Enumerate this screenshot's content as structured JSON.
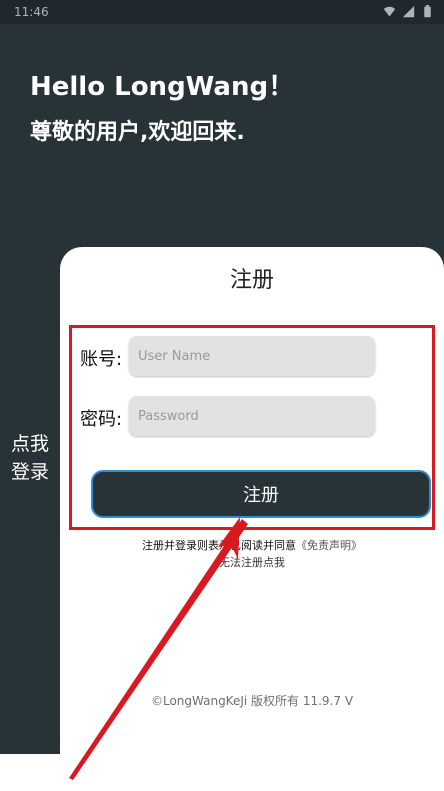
{
  "status_bar": {
    "time": "11:46"
  },
  "header": {
    "greeting": "Hello LongWang！",
    "subtitle": "尊敬的用户,欢迎回来."
  },
  "side_panel": {
    "login_label": "点我\n登录"
  },
  "register_form": {
    "title": "注册",
    "account_label": "账号:",
    "account_placeholder": "User Name",
    "password_label": "密码:",
    "password_placeholder": "Password",
    "submit_label": "注册"
  },
  "terms": {
    "prefix": "注册并登录则表示",
    "middle": "已阅读并同意",
    "link": "《免责声明》"
  },
  "cant_register": "无法注册点我",
  "copyright": "©LongWangKeJi 版权所有 11.9.7 V",
  "colors": {
    "dark_bg": "#283337",
    "highlight": "#d8191f",
    "button_border": "#2f8fd6"
  }
}
